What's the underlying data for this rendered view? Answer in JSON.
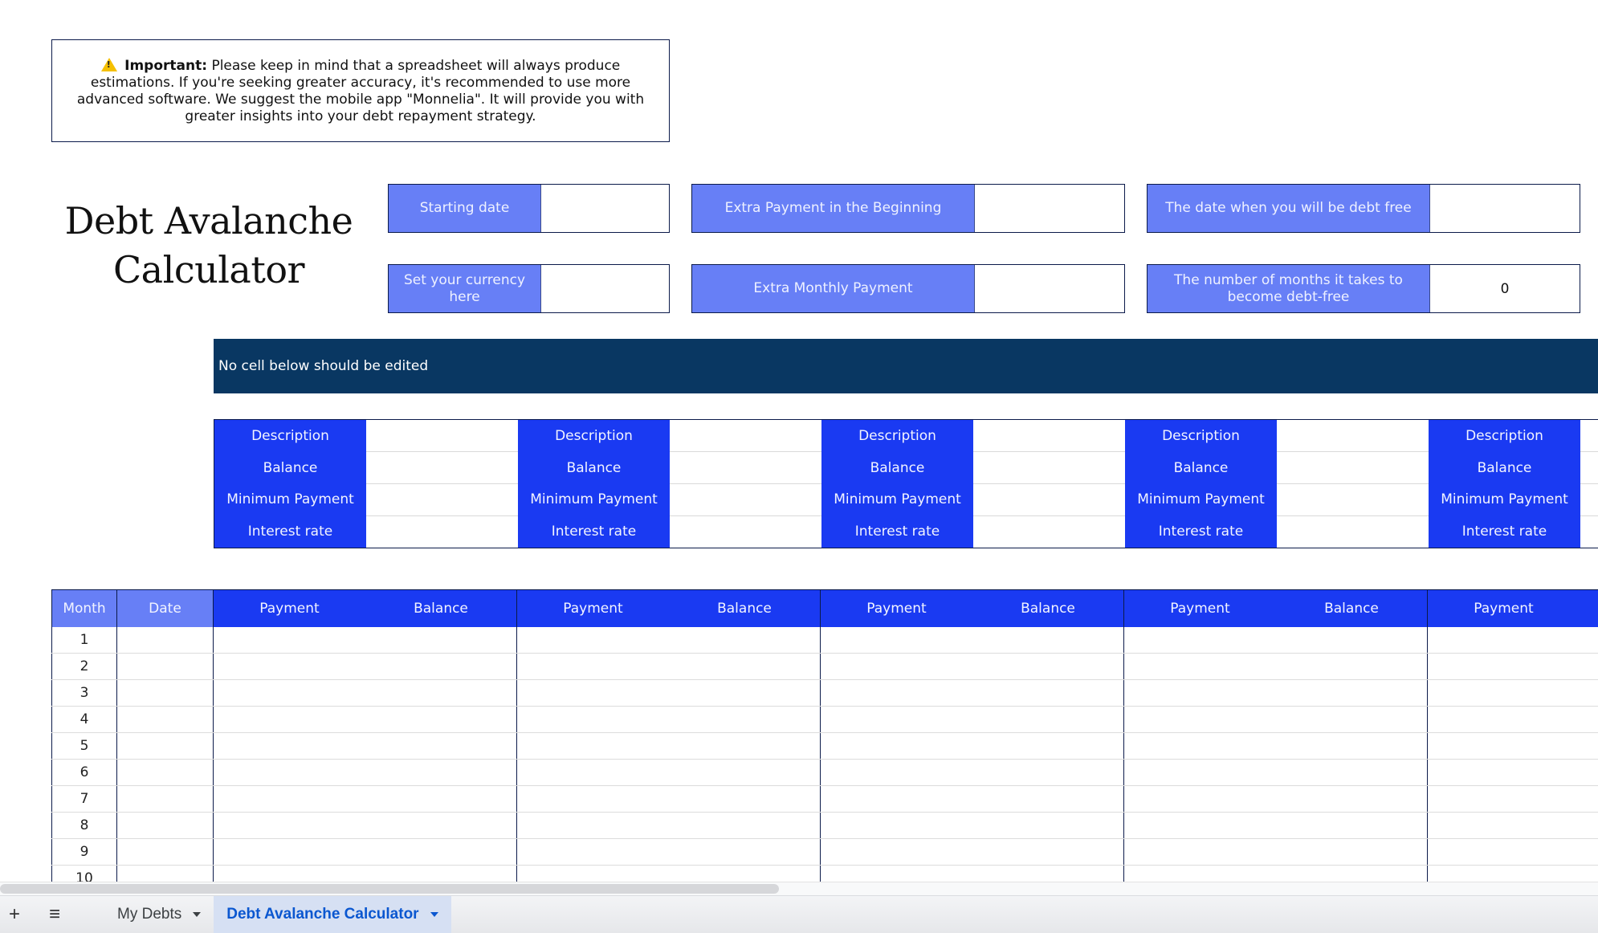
{
  "notice": {
    "icon": "warning-icon",
    "bold": "Important:",
    "text": " Please keep in mind that a spreadsheet will always produce estimations. If you're seeking greater accuracy, it's recommended to use more advanced software. We suggest the mobile app \"Monnelia\". It will provide you with greater insights into your debt repayment strategy."
  },
  "title": {
    "line1": "Debt Avalanche",
    "line2": "Calculator"
  },
  "inputs": {
    "starting_date": {
      "label": "Starting date",
      "value": ""
    },
    "currency": {
      "label": "Set your currency here",
      "value": ""
    },
    "extra_beginning": {
      "label": "Extra Payment in the Beginning",
      "value": ""
    },
    "extra_monthly": {
      "label": "Extra Monthly Payment",
      "value": ""
    },
    "debt_free_date": {
      "label": "The date when you will be debt free",
      "value": ""
    },
    "months_to_free": {
      "label": "The number of months it takes to become debt-free",
      "value": "0"
    }
  },
  "banner": {
    "text": "No cell below should be edited"
  },
  "debt_labels": {
    "description": "Description",
    "balance": "Balance",
    "minimum_payment": "Minimum Payment",
    "interest_rate": "Interest rate"
  },
  "debt_block_count": 5,
  "schedule": {
    "month_header": "Month",
    "date_header": "Date",
    "payment_header": "Payment",
    "balance_header": "Balance",
    "months": [
      "1",
      "2",
      "3",
      "4",
      "5",
      "6",
      "7",
      "8",
      "9",
      "10"
    ]
  },
  "colors": {
    "label_light": "#677ff6",
    "label_bright": "#1a3af2",
    "banner": "#093762",
    "border": "#0b1a4a"
  },
  "tabs": {
    "add_icon": "plus-icon",
    "menu_icon": "all-sheets-menu-icon",
    "items": [
      {
        "label": "My Debts",
        "active": false
      },
      {
        "label": "Debt Avalanche Calculator",
        "active": true
      }
    ]
  }
}
